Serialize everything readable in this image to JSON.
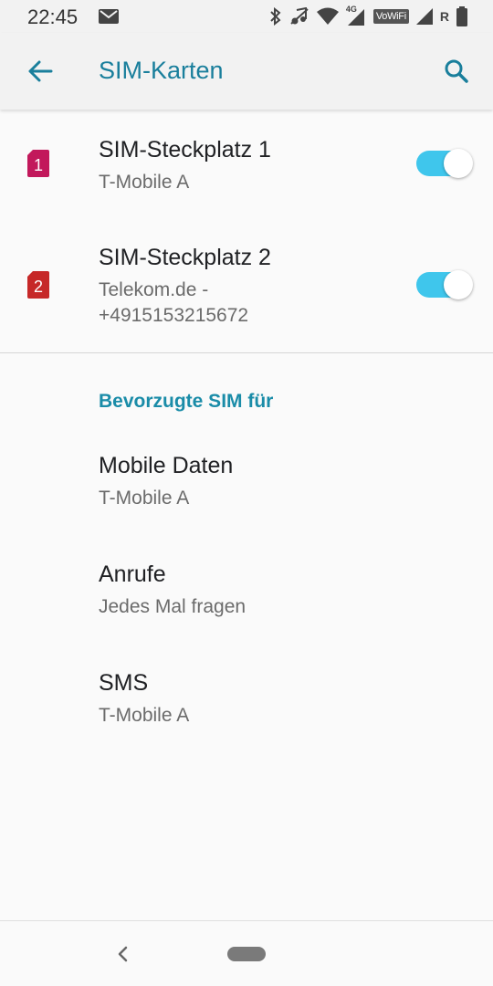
{
  "status_bar": {
    "time": "22:45",
    "icons": [
      "mail-icon",
      "bluetooth-icon",
      "music-off-icon",
      "wifi-icon",
      "signal-4g-icon",
      "vowifi-badge",
      "signal-icon",
      "roaming-indicator",
      "battery-icon"
    ],
    "vowifi_label": "VoWiFi",
    "roaming_label": "R",
    "network_label": "4G"
  },
  "app_bar": {
    "title": "SIM-Karten",
    "back_icon": "arrow-back-icon",
    "search_icon": "search-icon",
    "accent_color": "#1a7f9c"
  },
  "sim_slots": [
    {
      "badge": "1",
      "badge_color": "#c2185b",
      "title": "SIM-Steckplatz 1",
      "subtitle_lines": [
        "T-Mobile A"
      ],
      "enabled": true
    },
    {
      "badge": "2",
      "badge_color": "#c62828",
      "title": "SIM-Steckplatz 2",
      "subtitle_lines": [
        "Telekom.de -",
        "+4915153215672"
      ],
      "enabled": true
    }
  ],
  "preferred_section": {
    "header": "Bevorzugte SIM für",
    "items": [
      {
        "title": "Mobile Daten",
        "value": "T-Mobile A"
      },
      {
        "title": "Anrufe",
        "value": "Jedes Mal fragen"
      },
      {
        "title": "SMS",
        "value": "T-Mobile A"
      }
    ]
  },
  "nav_bar": {
    "back_icon": "nav-back-icon",
    "home_icon": "nav-home-pill"
  },
  "colors": {
    "toggle_on": "#3fc6ec",
    "section_header": "#1a8ca8"
  }
}
